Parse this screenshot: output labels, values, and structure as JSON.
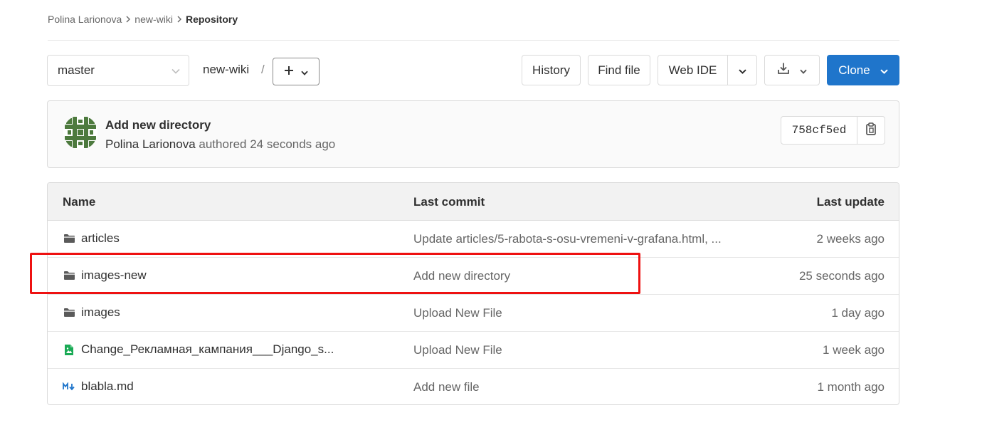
{
  "breadcrumb": {
    "items": [
      "Polina Larionova",
      "new-wiki",
      "Repository"
    ]
  },
  "toolbar": {
    "branch": "master",
    "path": "new-wiki",
    "path_separator": "/",
    "add_label": "+",
    "history_label": "History",
    "find_file_label": "Find file",
    "web_ide_label": "Web IDE",
    "clone_label": "Clone",
    "accent_color": "#1f75cb"
  },
  "commit": {
    "title": "Add new directory",
    "author": "Polina Larionova",
    "meta": "authored 24 seconds ago",
    "sha": "758cf5ed"
  },
  "table": {
    "headers": {
      "name": "Name",
      "last_commit": "Last commit",
      "last_update": "Last update"
    },
    "rows": [
      {
        "icon": "folder-icon",
        "name": "articles",
        "commit": "Update articles/5-rabota-s-osu-vremeni-v-grafana.html, ...",
        "updated": "2 weeks ago"
      },
      {
        "icon": "folder-icon",
        "name": "images-new",
        "commit": "Add new directory",
        "updated": "25 seconds ago"
      },
      {
        "icon": "folder-icon",
        "name": "images",
        "commit": "Upload New File",
        "updated": "1 day ago"
      },
      {
        "icon": "image-file-icon",
        "name": "Change_Рекламная_кампания___Django_s...",
        "commit": "Upload New File",
        "updated": "1 week ago"
      },
      {
        "icon": "markdown-file-icon",
        "name": "blabla.md",
        "commit": "Add new file",
        "updated": "1 month ago"
      }
    ]
  },
  "annotation": {
    "color": "#ee1111",
    "highlighted_row": "images-new"
  }
}
